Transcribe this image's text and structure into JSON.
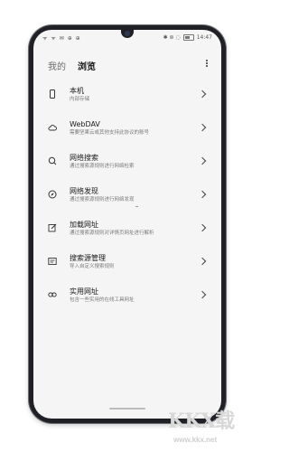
{
  "status": {
    "left": "ᯤ ᯤ ✉ ⊕ ⊕",
    "right_icons": "✱ ⊚ ◌",
    "time": "14:47"
  },
  "tabs": [
    {
      "label": "我的",
      "active": false
    },
    {
      "label": "浏览",
      "active": true
    }
  ],
  "items": [
    {
      "title": "本机",
      "subtitle": "内部存储",
      "icon": "phone-icon"
    },
    {
      "title": "WebDAV",
      "subtitle": "需要坚果云或其他支持此协议的账号",
      "icon": "cloud-icon"
    },
    {
      "title": "网络搜索",
      "subtitle": "通过搜索源规则进行网络检索",
      "icon": "search-icon"
    },
    {
      "title": "网络发现",
      "subtitle": "通过搜索源规则进行网络发现",
      "icon": "compass-icon"
    },
    {
      "title": "加载网址",
      "subtitle": "通过搜索源规则对详情页网址进行解析",
      "icon": "edit-icon"
    },
    {
      "title": "搜索源管理",
      "subtitle": "导入自定义搜索规则",
      "icon": "source-icon"
    },
    {
      "title": "实用网址",
      "subtitle": "包含一些实用的在线工具网址",
      "icon": "link-icon"
    }
  ],
  "watermark": {
    "logo": "KKX载",
    "url": "www.kkx.net"
  }
}
